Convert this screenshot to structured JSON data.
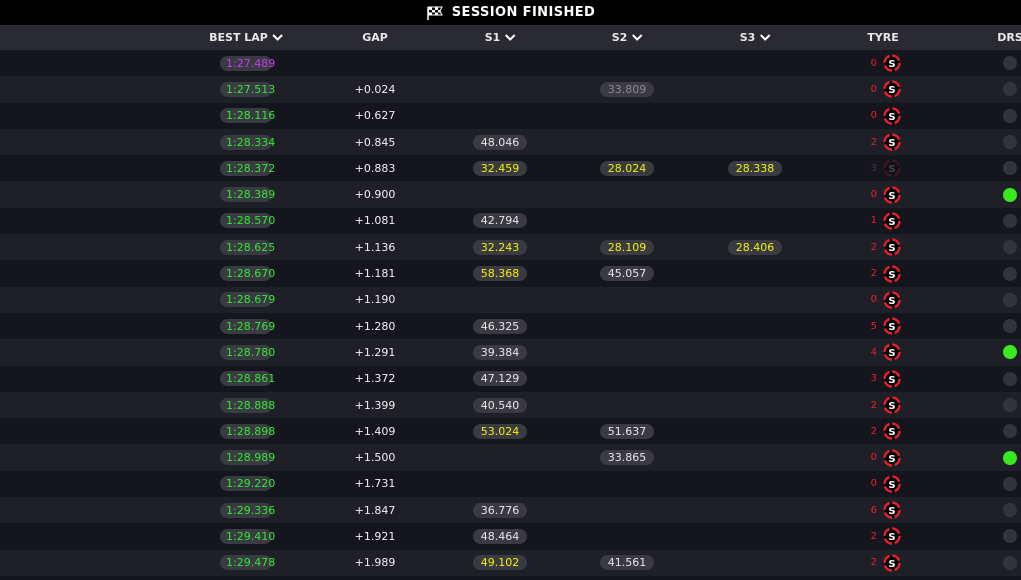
{
  "title": "SESSION FINISHED",
  "columns": {
    "best_lap": "BEST LAP",
    "gap": "GAP",
    "s1": "S1",
    "s2": "S2",
    "s3": "S3",
    "tyre": "TYRE",
    "drs": "DRS"
  },
  "colors": {
    "personal_best": "#32e632",
    "fastest": "#c03cf0",
    "sector_yellow": "#f2f000",
    "tyre_soft": "#e8202a",
    "drs_active": "#39e81f"
  },
  "tyre_compound_label": "S",
  "rows": [
    {
      "best_lap": "1:27.489",
      "lap_color": "purple",
      "gap": "",
      "s1": "",
      "s1c": "",
      "s2": "",
      "s2c": "",
      "s3": "",
      "s3c": "",
      "tyre_age": "0",
      "tyre_dim": false,
      "drs": false
    },
    {
      "best_lap": "1:27.513",
      "lap_color": "green",
      "gap": "+0.024",
      "s1": "",
      "s1c": "",
      "s2": "33.809",
      "s2c": "grey",
      "s3": "",
      "s3c": "",
      "tyre_age": "0",
      "tyre_dim": false,
      "drs": false
    },
    {
      "best_lap": "1:28.116",
      "lap_color": "green",
      "gap": "+0.627",
      "s1": "",
      "s1c": "",
      "s2": "",
      "s2c": "",
      "s3": "",
      "s3c": "",
      "tyre_age": "0",
      "tyre_dim": false,
      "drs": false
    },
    {
      "best_lap": "1:28.334",
      "lap_color": "green",
      "gap": "+0.845",
      "s1": "48.046",
      "s1c": "white",
      "s2": "",
      "s2c": "",
      "s3": "",
      "s3c": "",
      "tyre_age": "2",
      "tyre_dim": false,
      "drs": false
    },
    {
      "best_lap": "1:28.372",
      "lap_color": "green",
      "gap": "+0.883",
      "s1": "32.459",
      "s1c": "yellow",
      "s2": "28.024",
      "s2c": "yellow",
      "s3": "28.338",
      "s3c": "yellow",
      "tyre_age": "3",
      "tyre_dim": true,
      "drs": false
    },
    {
      "best_lap": "1:28.389",
      "lap_color": "green",
      "gap": "+0.900",
      "s1": "",
      "s1c": "",
      "s2": "",
      "s2c": "",
      "s3": "",
      "s3c": "",
      "tyre_age": "0",
      "tyre_dim": false,
      "drs": true
    },
    {
      "best_lap": "1:28.570",
      "lap_color": "green",
      "gap": "+1.081",
      "s1": "42.794",
      "s1c": "white",
      "s2": "",
      "s2c": "",
      "s3": "",
      "s3c": "",
      "tyre_age": "1",
      "tyre_dim": false,
      "drs": false
    },
    {
      "best_lap": "1:28.625",
      "lap_color": "green",
      "gap": "+1.136",
      "s1": "32.243",
      "s1c": "yellow",
      "s2": "28.109",
      "s2c": "yellow",
      "s3": "28.406",
      "s3c": "yellow",
      "tyre_age": "2",
      "tyre_dim": false,
      "drs": false
    },
    {
      "best_lap": "1:28.670",
      "lap_color": "green",
      "gap": "+1.181",
      "s1": "58.368",
      "s1c": "yellow",
      "s2": "45.057",
      "s2c": "white",
      "s3": "",
      "s3c": "",
      "tyre_age": "2",
      "tyre_dim": false,
      "drs": false
    },
    {
      "best_lap": "1:28.679",
      "lap_color": "green",
      "gap": "+1.190",
      "s1": "",
      "s1c": "",
      "s2": "",
      "s2c": "",
      "s3": "",
      "s3c": "",
      "tyre_age": "0",
      "tyre_dim": false,
      "drs": false
    },
    {
      "best_lap": "1:28.769",
      "lap_color": "green",
      "gap": "+1.280",
      "s1": "46.325",
      "s1c": "white",
      "s2": "",
      "s2c": "",
      "s3": "",
      "s3c": "",
      "tyre_age": "5",
      "tyre_dim": false,
      "drs": false
    },
    {
      "best_lap": "1:28.780",
      "lap_color": "green",
      "gap": "+1.291",
      "s1": "39.384",
      "s1c": "white",
      "s2": "",
      "s2c": "",
      "s3": "",
      "s3c": "",
      "tyre_age": "4",
      "tyre_dim": false,
      "drs": true
    },
    {
      "best_lap": "1:28.861",
      "lap_color": "green",
      "gap": "+1.372",
      "s1": "47.129",
      "s1c": "white",
      "s2": "",
      "s2c": "",
      "s3": "",
      "s3c": "",
      "tyre_age": "3",
      "tyre_dim": false,
      "drs": false
    },
    {
      "best_lap": "1:28.888",
      "lap_color": "green",
      "gap": "+1.399",
      "s1": "40.540",
      "s1c": "white",
      "s2": "",
      "s2c": "",
      "s3": "",
      "s3c": "",
      "tyre_age": "2",
      "tyre_dim": false,
      "drs": false
    },
    {
      "best_lap": "1:28.898",
      "lap_color": "green",
      "gap": "+1.409",
      "s1": "53.024",
      "s1c": "yellow",
      "s2": "51.637",
      "s2c": "white",
      "s3": "",
      "s3c": "",
      "tyre_age": "2",
      "tyre_dim": false,
      "drs": false
    },
    {
      "best_lap": "1:28.989",
      "lap_color": "green",
      "gap": "+1.500",
      "s1": "",
      "s1c": "",
      "s2": "33.865",
      "s2c": "white",
      "s3": "",
      "s3c": "",
      "tyre_age": "0",
      "tyre_dim": false,
      "drs": true
    },
    {
      "best_lap": "1:29.220",
      "lap_color": "green",
      "gap": "+1.731",
      "s1": "",
      "s1c": "",
      "s2": "",
      "s2c": "",
      "s3": "",
      "s3c": "",
      "tyre_age": "0",
      "tyre_dim": false,
      "drs": false
    },
    {
      "best_lap": "1:29.336",
      "lap_color": "green",
      "gap": "+1.847",
      "s1": "36.776",
      "s1c": "white",
      "s2": "",
      "s2c": "",
      "s3": "",
      "s3c": "",
      "tyre_age": "6",
      "tyre_dim": false,
      "drs": false
    },
    {
      "best_lap": "1:29.410",
      "lap_color": "green",
      "gap": "+1.921",
      "s1": "48.464",
      "s1c": "white",
      "s2": "",
      "s2c": "",
      "s3": "",
      "s3c": "",
      "tyre_age": "2",
      "tyre_dim": false,
      "drs": false
    },
    {
      "best_lap": "1:29.478",
      "lap_color": "green",
      "gap": "+1.989",
      "s1": "49.102",
      "s1c": "yellow",
      "s2": "41.561",
      "s2c": "white",
      "s3": "",
      "s3c": "",
      "tyre_age": "2",
      "tyre_dim": false,
      "drs": false
    }
  ]
}
